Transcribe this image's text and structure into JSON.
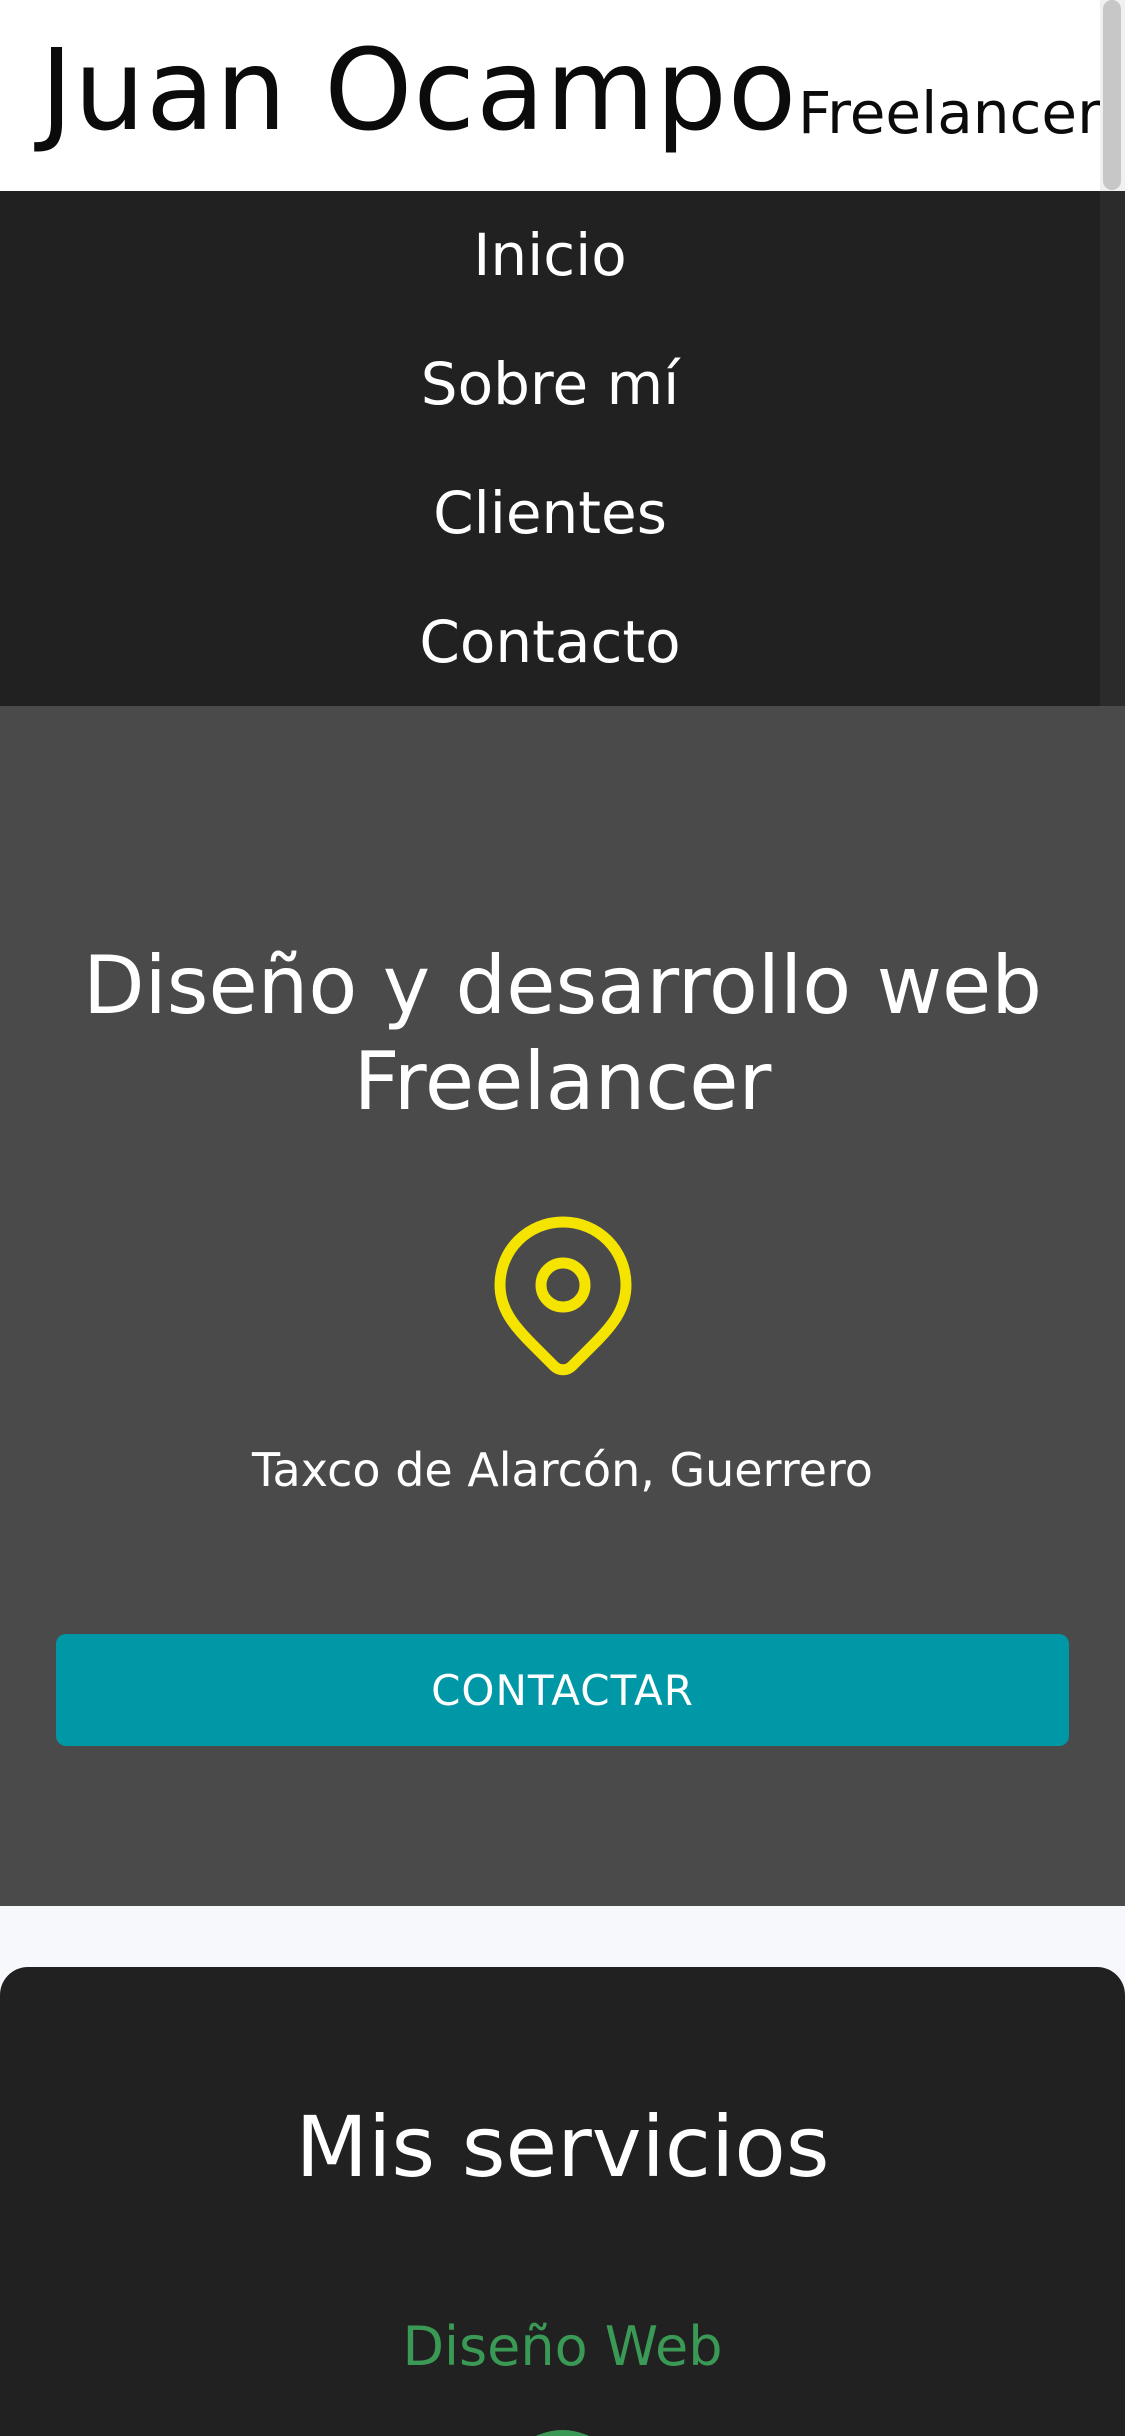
{
  "header": {
    "name": "Juan Ocampo",
    "tagline": "Freelancer"
  },
  "nav": {
    "items": [
      {
        "label": "Inicio"
      },
      {
        "label": "Sobre mí"
      },
      {
        "label": "Clientes"
      },
      {
        "label": "Contacto"
      }
    ]
  },
  "hero": {
    "title_line1": "Diseño y desarrollo web",
    "title_line2": "Freelancer",
    "location_icon": "map-pin-icon",
    "location": "Taxco de Alarcón, Guerrero",
    "cta_label": "CONTACTAR"
  },
  "services": {
    "title": "Mis servicios",
    "first_service": "Diseño Web"
  },
  "colors": {
    "header_bg": "#ffffff",
    "nav_bg": "#212121",
    "hero_bg": "#4a4a4b",
    "accent_yellow": "#f5e400",
    "button_teal": "#0097a6",
    "service_green": "#3a9a55"
  }
}
